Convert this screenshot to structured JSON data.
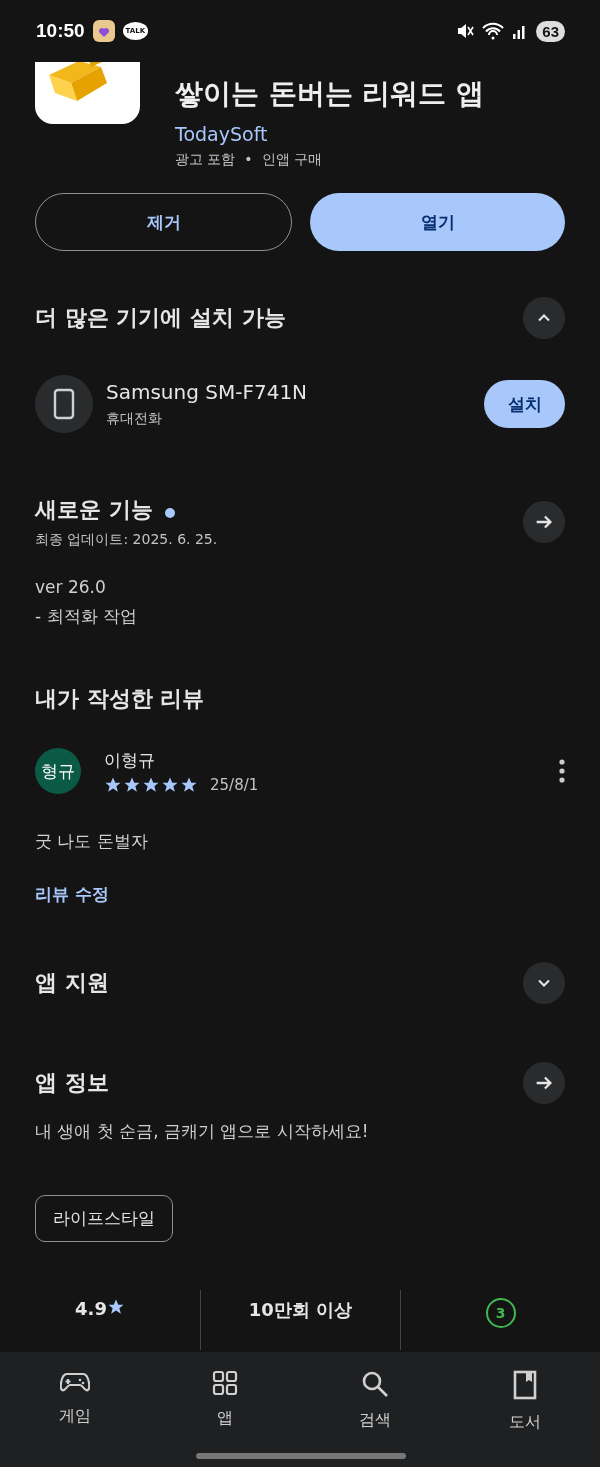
{
  "status_bar": {
    "time": "10:50",
    "talk_badge": "TALK",
    "battery": "63"
  },
  "app": {
    "title": "쌓이는 돈버는 리워드 앱",
    "developer": "TodaySoft",
    "meta": "광고 포함  •  인앱 구매"
  },
  "actions": [
    {
      "label": "제거",
      "kind": "outline"
    },
    {
      "label": "열기",
      "kind": "filled"
    }
  ],
  "devices_section": {
    "title": "더 많은 기기에 설치 가능",
    "expanded": true,
    "device": {
      "name": "Samsung SM-F741N",
      "type": "휴대전화",
      "button": "설치"
    }
  },
  "whats_new": {
    "title": "새로운 기능",
    "new_dot": true,
    "updated": "최종 업데이트: 2025. 6. 25.",
    "lines": [
      "ver 26.0",
      "- 최적화 작업"
    ]
  },
  "my_review": {
    "title": "내가 작성한 리뷰",
    "avatar": "형규",
    "author": "이형규",
    "stars": 5,
    "date": "25/8/1",
    "text": "굿 나도 돈벌자",
    "edit_link": "리뷰 수정"
  },
  "app_support": {
    "title": "앱 지원",
    "expanded": false
  },
  "app_info": {
    "title": "앱 정보",
    "description": "내 생애 첫 순금, 금캐기 앱으로 시작하세요!",
    "chip": "라이프스타일"
  },
  "stats": [
    {
      "kind": "rating",
      "value": "4.9"
    },
    {
      "kind": "downloads",
      "value": "10만회 이상"
    },
    {
      "kind": "age",
      "value": "3"
    }
  ],
  "bottom_nav": [
    {
      "label": "게임",
      "kind": "gamepad",
      "selected": false
    },
    {
      "label": "앱",
      "kind": "grid",
      "selected": false
    },
    {
      "label": "검색",
      "kind": "search",
      "selected": false
    },
    {
      "label": "도서",
      "kind": "book",
      "selected": false
    }
  ]
}
